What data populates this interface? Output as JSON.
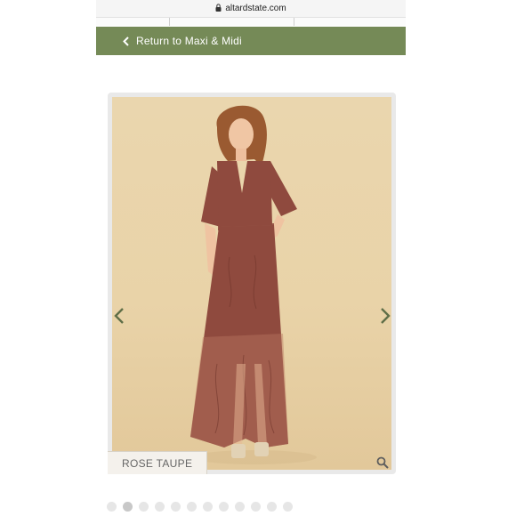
{
  "browser": {
    "url": "altardstate.com"
  },
  "nav": {
    "back_label": "Return to Maxi & Midi",
    "background": "#758a57"
  },
  "product": {
    "color_label": "ROSE TAUPE",
    "dress_color": "#8f4a3e"
  },
  "gallery": {
    "slide_count": 12,
    "active_index": 1
  },
  "icons": [
    "lock-icon",
    "chevron-left-icon",
    "arrow-left-icon",
    "arrow-right-icon",
    "magnifier-icon"
  ]
}
